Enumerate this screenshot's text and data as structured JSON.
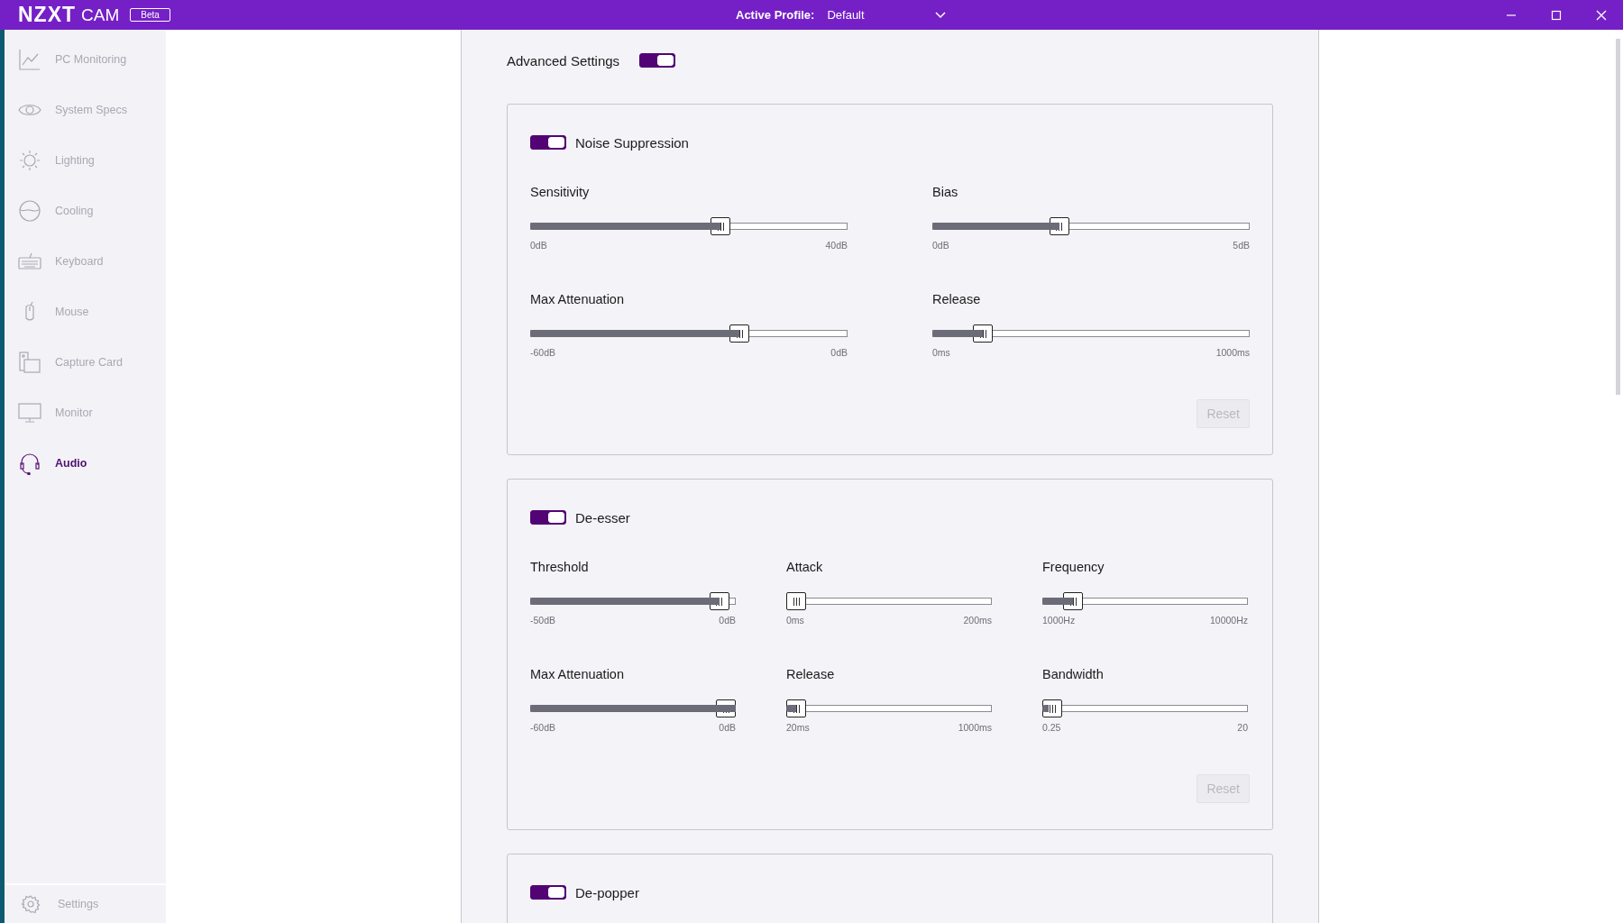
{
  "titlebar": {
    "logo": "NZXT",
    "product": "CAM",
    "badge": "Beta",
    "profile_label": "Active Profile:",
    "profile_value": "Default"
  },
  "sidebar": {
    "items": [
      {
        "label": "PC Monitoring",
        "selected": false
      },
      {
        "label": "System Specs",
        "selected": false
      },
      {
        "label": "Lighting",
        "selected": false
      },
      {
        "label": "Cooling",
        "selected": false
      },
      {
        "label": "Keyboard",
        "selected": false
      },
      {
        "label": "Mouse",
        "selected": false
      },
      {
        "label": "Capture Card",
        "selected": false
      },
      {
        "label": "Monitor",
        "selected": false
      },
      {
        "label": "Audio",
        "selected": true
      }
    ],
    "footer": {
      "label": "Settings"
    }
  },
  "advanced_settings": {
    "label": "Advanced Settings",
    "on": true
  },
  "sections": [
    {
      "title": "Noise Suppression",
      "on": true,
      "kind": "two-column",
      "sliders": [
        {
          "label": "Sensitivity",
          "min": "0dB",
          "max": "40dB",
          "level": 0.6
        },
        {
          "label": "Bias",
          "min": "0dB",
          "max": "5dB",
          "level": 0.4
        },
        {
          "label": "Max Attenuation",
          "min": "-60dB",
          "max": "0dB",
          "level": 0.66
        },
        {
          "label": "Release",
          "min": "0ms",
          "max": "1000ms",
          "level": 0.16
        }
      ],
      "reset": {
        "label": "Reset",
        "disabled": true
      }
    },
    {
      "title": "De-esser",
      "on": true,
      "kind": "three-column",
      "sliders": [
        {
          "label": "Threshold",
          "min": "-50dB",
          "max": "0dB",
          "level": 0.92
        },
        {
          "label": "Attack",
          "min": "0ms",
          "max": "200ms",
          "level": 0
        },
        {
          "label": "Frequency",
          "min": "1000Hz",
          "max": "10000Hz",
          "level": 0.15
        },
        {
          "label": "Max Attenuation",
          "min": "-60dB",
          "max": "0dB",
          "level": 1
        },
        {
          "label": "Release",
          "min": "20ms",
          "max": "1000ms",
          "level": 0.05
        },
        {
          "label": "Bandwidth",
          "min": "0.25",
          "max": "20",
          "level": 0.03
        }
      ],
      "reset": {
        "label": "Reset",
        "disabled": true
      }
    },
    {
      "title": "De-popper",
      "on": true
    }
  ]
}
